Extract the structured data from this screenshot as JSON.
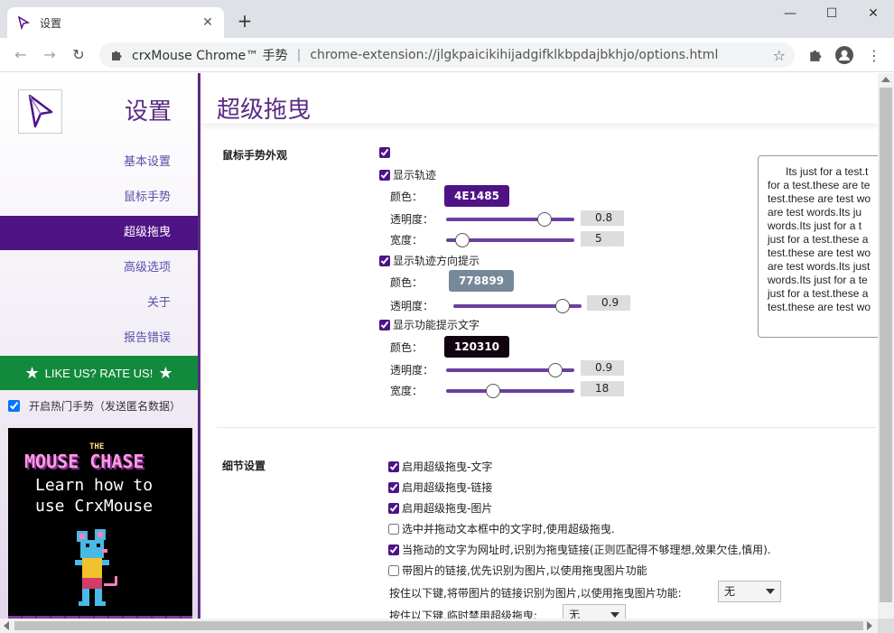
{
  "browser": {
    "tab_title": "设置",
    "tab_close": "✕",
    "new_tab": "+",
    "minimize": "—",
    "maximize": "☐",
    "close": "✕",
    "back": "←",
    "forward": "→",
    "reload": "↻",
    "site_name": "crxMouse Chrome™ 手势",
    "separator": "|",
    "url": "chrome-extension://jlgkpaicikihijadgifklkbpdajbkhjo/options.html",
    "bookmark": "☆",
    "menu": "⋮"
  },
  "sidebar": {
    "title": "设置",
    "items": [
      {
        "label": "基本设置",
        "active": false
      },
      {
        "label": "鼠标手势",
        "active": false
      },
      {
        "label": "超级拖曳",
        "active": true
      },
      {
        "label": "高级选项",
        "active": false
      },
      {
        "label": "关于",
        "active": false
      },
      {
        "label": "报告错误",
        "active": false
      }
    ],
    "rate_star": "★",
    "rate_label": "LIKE US? RATE US!",
    "hot_label": "开启热门手势（发送匿名数据）",
    "promo": {
      "the": "THE",
      "title": "MOUSE CHASE",
      "line1": "Learn how to",
      "line2": "use CrxMouse"
    }
  },
  "main": {
    "title": "超级拖曳",
    "appearance": {
      "section_label": "鼠标手势外观",
      "show_trail": "显示轨迹",
      "trail_color_label": "颜色：",
      "trail_color": "4E1485",
      "trail_color_hex": "#4e1485",
      "trail_opacity_label": "透明度：",
      "trail_opacity": "0.8",
      "trail_width_label": "宽度：",
      "trail_width": "5",
      "show_direction": "显示轨迹方向提示",
      "dir_color_label": "颜色：",
      "dir_color": "778899",
      "dir_color_hex": "#778899",
      "dir_opacity_label": "透明度：",
      "dir_opacity": "0.9",
      "show_text": "显示功能提示文字",
      "text_color_label": "颜色：",
      "text_color": "120310",
      "text_color_hex": "#120310",
      "text_opacity_label": "透明度：",
      "text_opacity": "0.9",
      "text_width_label": "宽度：",
      "text_width": "18",
      "preview_text": "      Its just for a test.t\nfor a test.these are te\ntest.these are test wo\nare test words.Its ju\nwords.Its just for a t\njust for a test.these a\ntest.these are test wo\nare test words.Its just\nwords.Its just for a te\njust for a test.these a\ntest.these are test wo"
    },
    "details": {
      "section_label": "细节设置",
      "opt1": "启用超级拖曳-文字",
      "opt2": "启用超级拖曳-链接",
      "opt3": "启用超级拖曳-图片",
      "opt4": "选中并拖动文本框中的文字时,使用超级拖曳.",
      "opt5": "当拖动的文字为网址时,识别为拖曳链接(正则匹配得不够理想,效果欠佳,慎用).",
      "opt6": "带图片的链接,优先识别为图片,以使用拖曳图片功能",
      "key1_label": "按住以下键,将带图片的链接识别为图片,以使用拖曳图片功能:",
      "key1_value": "无",
      "key2_label": "按住以下键,临时禁用超级拖曳:",
      "key2_value": "无"
    }
  }
}
